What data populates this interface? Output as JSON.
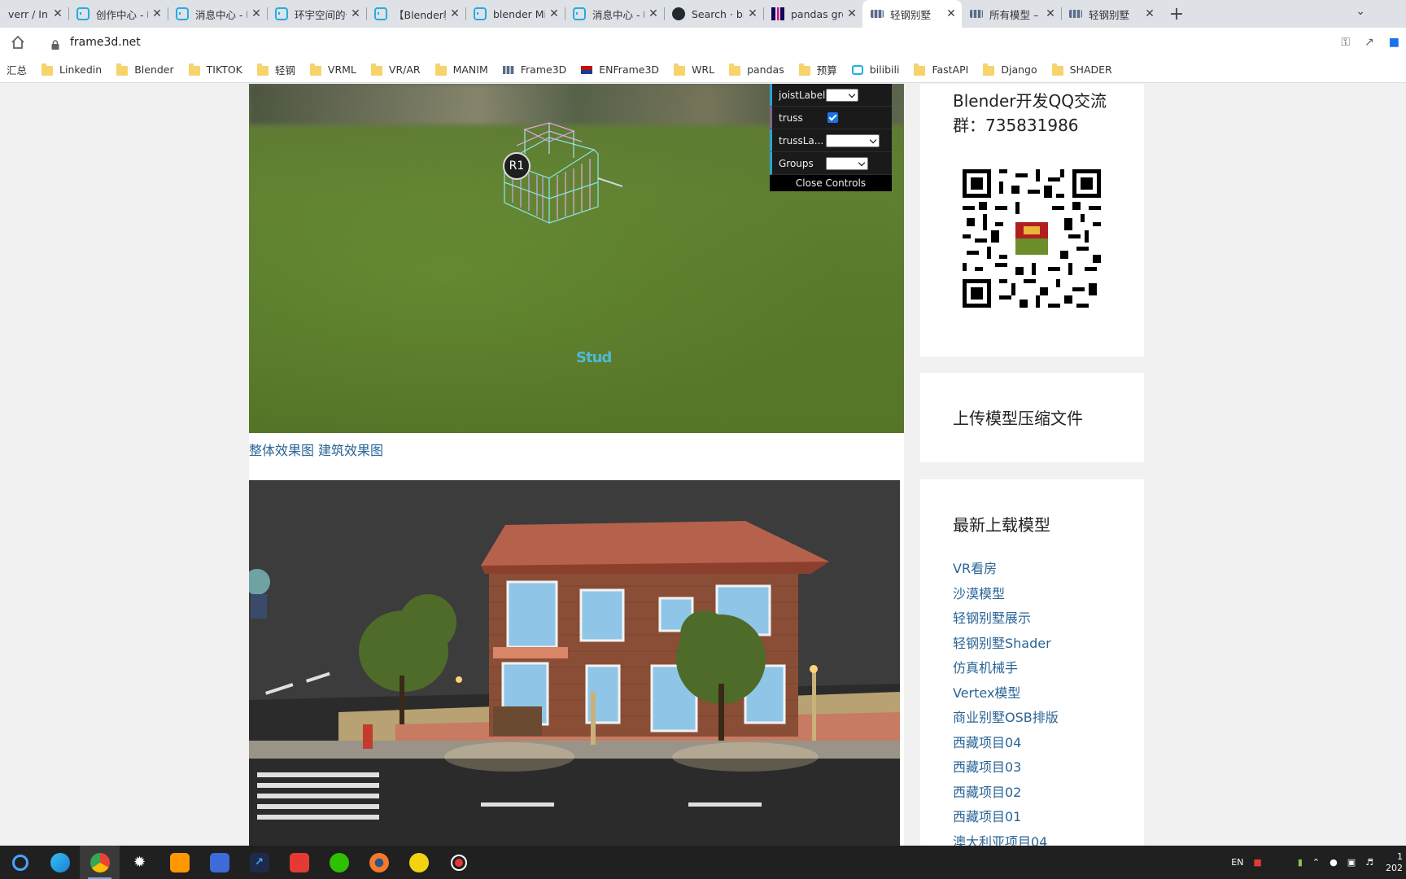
{
  "browser": {
    "tabs": [
      {
        "title": "verr / Inbo",
        "favicon": "none",
        "active": false
      },
      {
        "title": "创作中心 - 哔",
        "favicon": "bilibili-icon",
        "active": false
      },
      {
        "title": "消息中心 - 哔",
        "favicon": "bilibili-icon",
        "active": false
      },
      {
        "title": "环宇空间的个",
        "favicon": "bilibili-icon",
        "active": false
      },
      {
        "title": "【Blender教",
        "favicon": "bilibili-icon",
        "active": false
      },
      {
        "title": "blender Mix",
        "favicon": "bilibili-icon",
        "active": false
      },
      {
        "title": "消息中心 - 哔",
        "favicon": "bilibili-icon",
        "active": false
      },
      {
        "title": "Search · ble",
        "favicon": "github-icon",
        "active": false
      },
      {
        "title": "pandas grou",
        "favicon": "pandas-icon",
        "active": false
      },
      {
        "title": "轻钢别墅",
        "favicon": "frame3d-icon",
        "active": true
      },
      {
        "title": "所有模型 – 轻",
        "favicon": "frame3d-icon",
        "active": false
      },
      {
        "title": "轻钢别墅",
        "favicon": "frame3d-icon",
        "active": false
      }
    ],
    "url": "frame3d.net",
    "bookmarks": [
      {
        "label": "汇总",
        "icon": "none"
      },
      {
        "label": "Linkedin",
        "icon": "folder-icon"
      },
      {
        "label": "Blender",
        "icon": "folder-icon"
      },
      {
        "label": "TIKTOK",
        "icon": "folder-icon"
      },
      {
        "label": "轻钢",
        "icon": "folder-icon"
      },
      {
        "label": "VRML",
        "icon": "folder-icon"
      },
      {
        "label": "VR/AR",
        "icon": "folder-icon"
      },
      {
        "label": "MANIM",
        "icon": "folder-icon"
      },
      {
        "label": "Frame3D",
        "icon": "frame3d-icon"
      },
      {
        "label": "ENFrame3D",
        "icon": "enframe-icon"
      },
      {
        "label": "WRL",
        "icon": "folder-icon"
      },
      {
        "label": "pandas",
        "icon": "folder-icon"
      },
      {
        "label": "预算",
        "icon": "folder-icon"
      },
      {
        "label": "bilibili",
        "icon": "bilibili-icon"
      },
      {
        "label": "FastAPI",
        "icon": "folder-icon"
      },
      {
        "label": "Django",
        "icon": "folder-icon"
      },
      {
        "label": "SHADER",
        "icon": "folder-icon"
      }
    ]
  },
  "viewer": {
    "marker": "R1",
    "stud_label": "Stud",
    "controls": {
      "joist_label": "joistLabel",
      "truss": "truss",
      "truss_checked": true,
      "truss_label": "trussLa...",
      "groups": "Groups",
      "close": "Close Controls"
    }
  },
  "caption": {
    "link1": "整体效果图",
    "link2": "建筑效果图"
  },
  "sidebar": {
    "qq_title": "Blender开发QQ交流群：735831986",
    "upload_title": "上传模型压缩文件",
    "latest_title": "最新上载模型",
    "latest_items": [
      "VR看房",
      "沙漠模型",
      "轻钢别墅展示",
      "轻钢别墅Shader",
      "仿真机械手",
      "Vertex模型",
      "商业别墅OSB排版",
      "西藏项目04",
      "西藏项目03",
      "西藏项目02",
      "西藏项目01",
      "澳大利亚项目04"
    ]
  },
  "taskbar": {
    "apps": [
      "start-icon",
      "edge-icon",
      "chrome-icon",
      "spider-icon",
      "sublime-icon",
      "report-icon",
      "chart-icon",
      "app-icon",
      "wechat-icon",
      "blender-icon",
      "yellow-app-icon",
      "record-icon"
    ],
    "lang": "EN",
    "clock_time": "1",
    "clock_date": "202"
  },
  "colors": {
    "link": "#2a6496",
    "gui_number": "#2fa1d6",
    "gui_boolean": "#806787",
    "stud_label": "#4fb9d6"
  }
}
